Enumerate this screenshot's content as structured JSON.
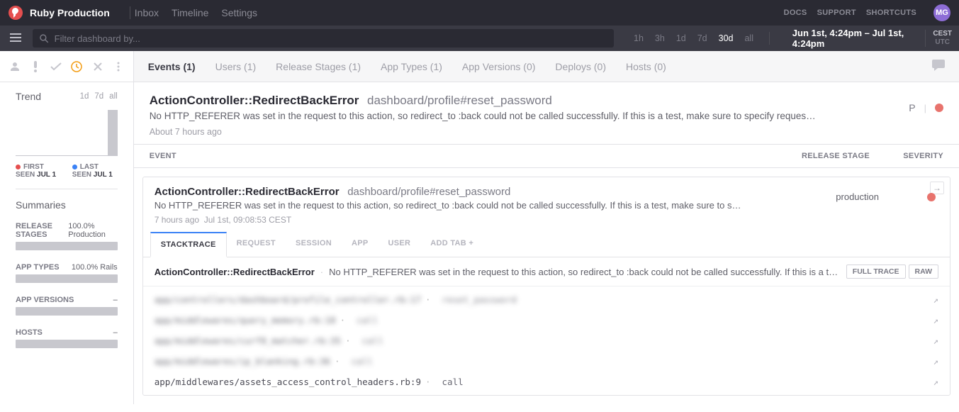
{
  "header": {
    "project": "Ruby Production",
    "nav": [
      "Inbox",
      "Timeline",
      "Settings"
    ],
    "top_links": [
      "DOCS",
      "SUPPORT",
      "SHORTCUTS"
    ],
    "avatar": "MG"
  },
  "filter": {
    "placeholder": "Filter dashboard by...",
    "ranges": [
      "1h",
      "3h",
      "1d",
      "7d",
      "30d",
      "all"
    ],
    "active_range": "30d",
    "date_range": "Jun 1st, 4:24pm  –  Jul 1st, 4:24pm",
    "tz1": "CEST",
    "tz2": "UTC"
  },
  "sidebar": {
    "trend": {
      "title": "Trend",
      "opts": [
        "1d",
        "7d",
        "all"
      ]
    },
    "seen": {
      "first_label": "FIRST SEEN",
      "first_val": "JUL 1",
      "last_label": "LAST SEEN",
      "last_val": "JUL 1"
    },
    "summaries_title": "Summaries",
    "summaries": [
      {
        "label": "RELEASE STAGES",
        "val": "100.0% Production"
      },
      {
        "label": "APP TYPES",
        "val": "100.0% Rails"
      },
      {
        "label": "APP VERSIONS",
        "val": "–"
      },
      {
        "label": "HOSTS",
        "val": "–"
      }
    ]
  },
  "tabs": [
    "Events (1)",
    "Users (1)",
    "Release Stages (1)",
    "App Types (1)",
    "App Versions (0)",
    "Deploys (0)",
    "Hosts (0)"
  ],
  "error": {
    "class": "ActionController::RedirectBackError",
    "context": "dashboard/profile#reset_password",
    "message": "No HTTP_REFERER was set in the request to this action, so redirect_to :back could not be called successfully. If this is a test, make sure to specify request...",
    "time": "About 7 hours ago",
    "pill": "P"
  },
  "table_head": {
    "event": "EVENT",
    "stage": "RELEASE STAGE",
    "sev": "SEVERITY"
  },
  "event": {
    "class": "ActionController::RedirectBackError",
    "context": "dashboard/profile#reset_password",
    "message": "No HTTP_REFERER was set in the request to this action, so redirect_to :back could not be called successfully. If this is a test, make sure to specify request...",
    "time_ago": "7 hours ago",
    "time_abs": "Jul 1st, 09:08:53 CEST",
    "stage": "production",
    "tabs": [
      "STACKTRACE",
      "REQUEST",
      "SESSION",
      "APP",
      "USER",
      "ADD TAB +"
    ],
    "st_class": "ActionController::RedirectBackError",
    "st_msg": "No HTTP_REFERER was set in the request to this action, so redirect_to :back could not be called successfully. If this is a test, m...",
    "btn_full": "FULL TRACE",
    "btn_raw": "RAW",
    "frames": [
      {
        "path": "app/controllers/dashboard/profile_controller.rb:17",
        "method": "reset_password",
        "blur": true
      },
      {
        "path": "app/middlewares/query_memory.rb:18",
        "method": "call",
        "blur": true
      },
      {
        "path": "app/middlewares/curf8_matcher.rb:35",
        "method": "call",
        "blur": true
      },
      {
        "path": "app/middlewares/ip_blanking.rb:36",
        "method": "call",
        "blur": true
      },
      {
        "path": "app/middlewares/assets_access_control_headers.rb:9",
        "method": "call",
        "blur": false
      }
    ]
  }
}
